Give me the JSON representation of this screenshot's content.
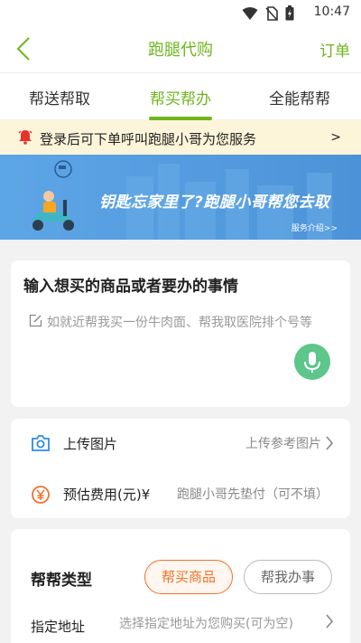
{
  "status_bar": {
    "time": "10:47",
    "icons": [
      "wifi-icon",
      "no-sim-icon",
      "battery-icon"
    ]
  },
  "nav": {
    "title": "跑腿代购",
    "orders": "订单"
  },
  "tabs": [
    {
      "label": "帮送帮取",
      "active": false
    },
    {
      "label": "帮买帮办",
      "active": true
    },
    {
      "label": "全能帮帮",
      "active": false
    }
  ],
  "notice": {
    "text": "登录后可下单呼叫跑腿小哥为您服务",
    "arrow": ">"
  },
  "banner": {
    "slogan": "钥匙忘家里了?跑腿小哥帮您去取",
    "intro": "服务介绍>>"
  },
  "request": {
    "heading": "输入想买的商品或者要办的事情",
    "placeholder": "如就近帮我买一份牛肉面、帮我取医院排个号等"
  },
  "upload": {
    "label": "上传图片",
    "value": "上传参考图片"
  },
  "fee": {
    "label": "预估费用(元)¥",
    "placeholder": "跑腿小哥先垫付（可不填）"
  },
  "help_type": {
    "title": "帮帮类型",
    "options": [
      "帮买商品",
      "帮我办事"
    ],
    "selected": "帮买商品"
  },
  "address": {
    "label": "指定地址",
    "value": "选择指定地址为您购买(可为空)"
  },
  "colors": {
    "accent": "#6fb51d",
    "orange": "#f2712a",
    "notice_bg": "#fdf5da",
    "banner": "#4c92d8",
    "mic": "#5cc68b"
  }
}
